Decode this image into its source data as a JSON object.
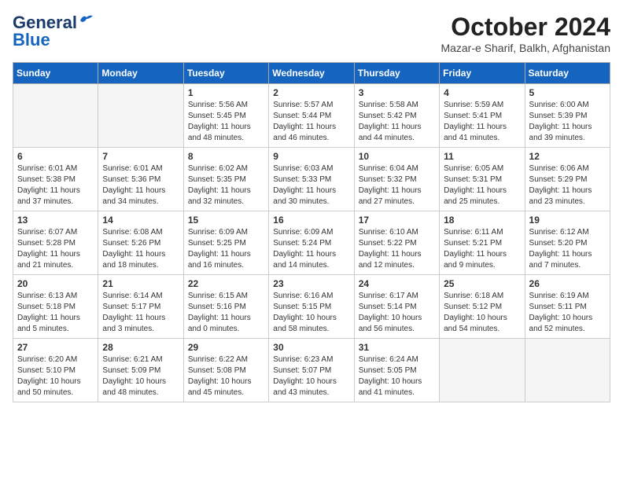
{
  "header": {
    "logo_line1": "General",
    "logo_line2": "Blue",
    "month_title": "October 2024",
    "location": "Mazar-e Sharif, Balkh, Afghanistan"
  },
  "weekdays": [
    "Sunday",
    "Monday",
    "Tuesday",
    "Wednesday",
    "Thursday",
    "Friday",
    "Saturday"
  ],
  "weeks": [
    [
      {
        "day": "",
        "empty": true
      },
      {
        "day": "",
        "empty": true
      },
      {
        "day": "1",
        "sunrise": "5:56 AM",
        "sunset": "5:45 PM",
        "daylight": "11 hours and 48 minutes."
      },
      {
        "day": "2",
        "sunrise": "5:57 AM",
        "sunset": "5:44 PM",
        "daylight": "11 hours and 46 minutes."
      },
      {
        "day": "3",
        "sunrise": "5:58 AM",
        "sunset": "5:42 PM",
        "daylight": "11 hours and 44 minutes."
      },
      {
        "day": "4",
        "sunrise": "5:59 AM",
        "sunset": "5:41 PM",
        "daylight": "11 hours and 41 minutes."
      },
      {
        "day": "5",
        "sunrise": "6:00 AM",
        "sunset": "5:39 PM",
        "daylight": "11 hours and 39 minutes."
      }
    ],
    [
      {
        "day": "6",
        "sunrise": "6:01 AM",
        "sunset": "5:38 PM",
        "daylight": "11 hours and 37 minutes."
      },
      {
        "day": "7",
        "sunrise": "6:01 AM",
        "sunset": "5:36 PM",
        "daylight": "11 hours and 34 minutes."
      },
      {
        "day": "8",
        "sunrise": "6:02 AM",
        "sunset": "5:35 PM",
        "daylight": "11 hours and 32 minutes."
      },
      {
        "day": "9",
        "sunrise": "6:03 AM",
        "sunset": "5:33 PM",
        "daylight": "11 hours and 30 minutes."
      },
      {
        "day": "10",
        "sunrise": "6:04 AM",
        "sunset": "5:32 PM",
        "daylight": "11 hours and 27 minutes."
      },
      {
        "day": "11",
        "sunrise": "6:05 AM",
        "sunset": "5:31 PM",
        "daylight": "11 hours and 25 minutes."
      },
      {
        "day": "12",
        "sunrise": "6:06 AM",
        "sunset": "5:29 PM",
        "daylight": "11 hours and 23 minutes."
      }
    ],
    [
      {
        "day": "13",
        "sunrise": "6:07 AM",
        "sunset": "5:28 PM",
        "daylight": "11 hours and 21 minutes."
      },
      {
        "day": "14",
        "sunrise": "6:08 AM",
        "sunset": "5:26 PM",
        "daylight": "11 hours and 18 minutes."
      },
      {
        "day": "15",
        "sunrise": "6:09 AM",
        "sunset": "5:25 PM",
        "daylight": "11 hours and 16 minutes."
      },
      {
        "day": "16",
        "sunrise": "6:09 AM",
        "sunset": "5:24 PM",
        "daylight": "11 hours and 14 minutes."
      },
      {
        "day": "17",
        "sunrise": "6:10 AM",
        "sunset": "5:22 PM",
        "daylight": "11 hours and 12 minutes."
      },
      {
        "day": "18",
        "sunrise": "6:11 AM",
        "sunset": "5:21 PM",
        "daylight": "11 hours and 9 minutes."
      },
      {
        "day": "19",
        "sunrise": "6:12 AM",
        "sunset": "5:20 PM",
        "daylight": "11 hours and 7 minutes."
      }
    ],
    [
      {
        "day": "20",
        "sunrise": "6:13 AM",
        "sunset": "5:18 PM",
        "daylight": "11 hours and 5 minutes."
      },
      {
        "day": "21",
        "sunrise": "6:14 AM",
        "sunset": "5:17 PM",
        "daylight": "11 hours and 3 minutes."
      },
      {
        "day": "22",
        "sunrise": "6:15 AM",
        "sunset": "5:16 PM",
        "daylight": "11 hours and 0 minutes."
      },
      {
        "day": "23",
        "sunrise": "6:16 AM",
        "sunset": "5:15 PM",
        "daylight": "10 hours and 58 minutes."
      },
      {
        "day": "24",
        "sunrise": "6:17 AM",
        "sunset": "5:14 PM",
        "daylight": "10 hours and 56 minutes."
      },
      {
        "day": "25",
        "sunrise": "6:18 AM",
        "sunset": "5:12 PM",
        "daylight": "10 hours and 54 minutes."
      },
      {
        "day": "26",
        "sunrise": "6:19 AM",
        "sunset": "5:11 PM",
        "daylight": "10 hours and 52 minutes."
      }
    ],
    [
      {
        "day": "27",
        "sunrise": "6:20 AM",
        "sunset": "5:10 PM",
        "daylight": "10 hours and 50 minutes."
      },
      {
        "day": "28",
        "sunrise": "6:21 AM",
        "sunset": "5:09 PM",
        "daylight": "10 hours and 48 minutes."
      },
      {
        "day": "29",
        "sunrise": "6:22 AM",
        "sunset": "5:08 PM",
        "daylight": "10 hours and 45 minutes."
      },
      {
        "day": "30",
        "sunrise": "6:23 AM",
        "sunset": "5:07 PM",
        "daylight": "10 hours and 43 minutes."
      },
      {
        "day": "31",
        "sunrise": "6:24 AM",
        "sunset": "5:05 PM",
        "daylight": "10 hours and 41 minutes."
      },
      {
        "day": "",
        "empty": true
      },
      {
        "day": "",
        "empty": true
      }
    ]
  ]
}
